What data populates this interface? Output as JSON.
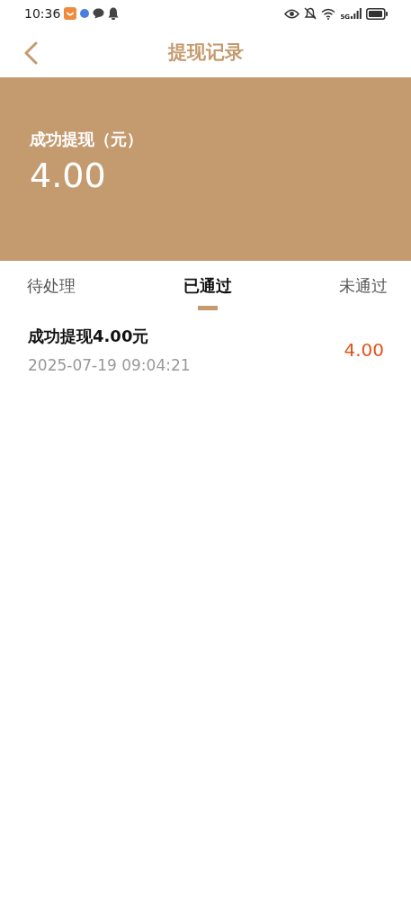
{
  "status_bar": {
    "time": "10:36",
    "network": "5G"
  },
  "header": {
    "title": "提现记录"
  },
  "summary": {
    "label": "成功提现（元）",
    "amount": "4.00"
  },
  "tabs": [
    {
      "label": "待处理",
      "selected": false
    },
    {
      "label": "已通过",
      "selected": true
    },
    {
      "label": "未通过",
      "selected": false
    }
  ],
  "records": [
    {
      "title": "成功提现4.00元",
      "time": "2025-07-19 09:04:21",
      "amount": "4.00"
    }
  ]
}
